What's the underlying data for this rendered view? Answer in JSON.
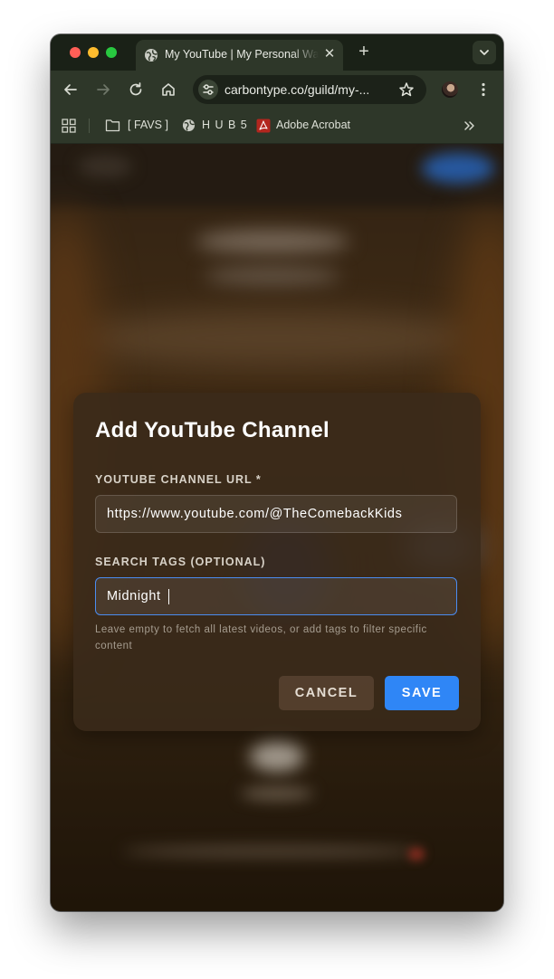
{
  "browser": {
    "tab_title": "My YouTube | My Personal Wa",
    "tab_close_icon": "close-icon",
    "new_tab_icon": "plus-icon",
    "url": "carbontype.co/guild/my-...",
    "bookmarks": [
      {
        "label": "[ FAVS ]",
        "icon": "folder-icon"
      },
      {
        "label": "H U B 5",
        "icon": "globe-icon"
      },
      {
        "label": "Adobe Acrobat",
        "icon": "acrobat-icon"
      }
    ]
  },
  "modal": {
    "title": "Add YouTube Channel",
    "url_field": {
      "label": "YOUTUBE CHANNEL URL *",
      "value": "https://www.youtube.com/@TheComebackKids"
    },
    "tags_field": {
      "label": "SEARCH TAGS (OPTIONAL)",
      "value": "Midnight"
    },
    "hint": "Leave empty to fetch all latest videos, or add tags to filter specific content",
    "cancel_label": "CANCEL",
    "save_label": "SAVE"
  },
  "colors": {
    "accent": "#2f86f6",
    "focus_border": "#4b8cf0"
  }
}
